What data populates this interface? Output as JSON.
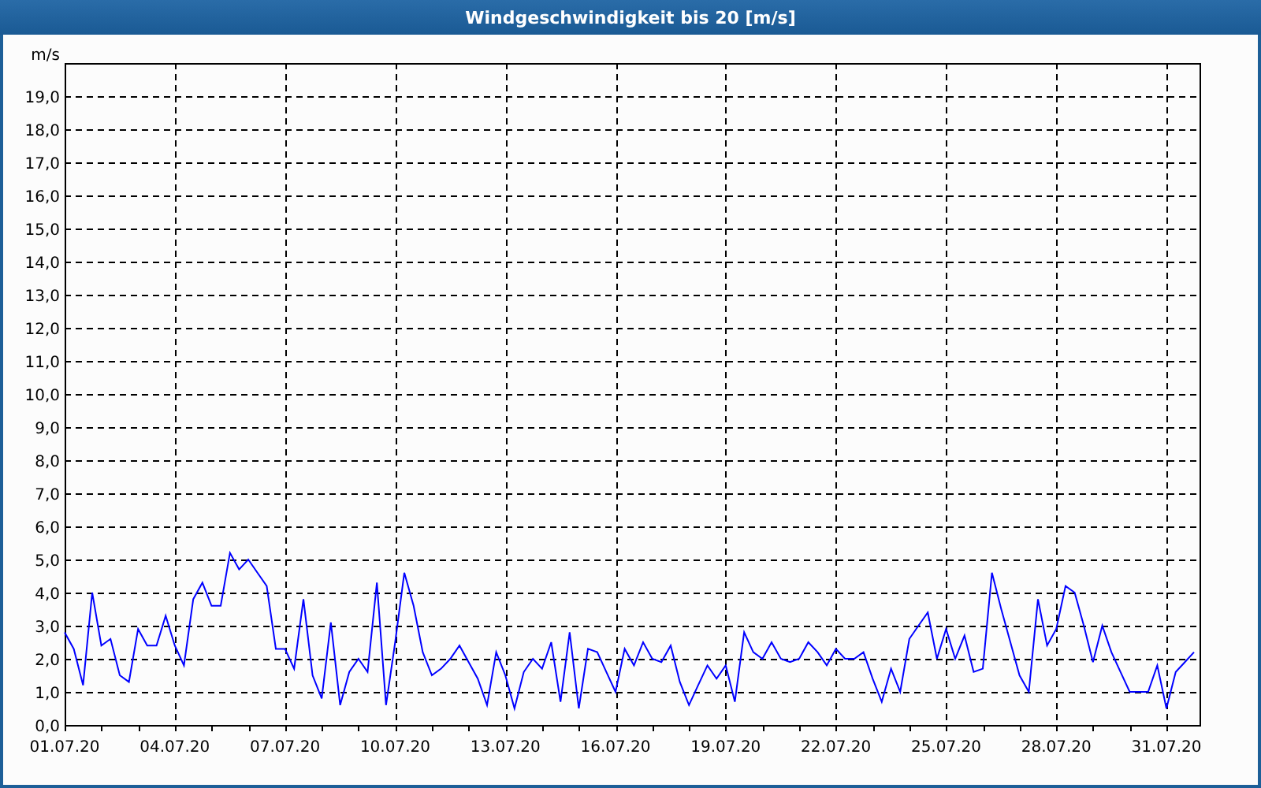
{
  "window": {
    "title": "Windgeschwindigkeit bis 20 [m/s]"
  },
  "chart_data": {
    "type": "line",
    "ylabel": "m/s",
    "categories": [
      "01.07.20",
      null,
      null,
      null,
      null,
      null,
      null,
      null,
      null,
      null,
      null,
      null,
      "04.07.20",
      null,
      null,
      null,
      null,
      null,
      null,
      null,
      null,
      null,
      null,
      null,
      "07.07.20",
      null,
      null,
      null,
      null,
      null,
      null,
      null,
      null,
      null,
      null,
      null,
      "10.07.20",
      null,
      null,
      null,
      null,
      null,
      null,
      null,
      null,
      null,
      null,
      null,
      "13.07.20",
      null,
      null,
      null,
      null,
      null,
      null,
      null,
      null,
      null,
      null,
      null,
      "16.07.20",
      null,
      null,
      null,
      null,
      null,
      null,
      null,
      null,
      null,
      null,
      null,
      "19.07.20",
      null,
      null,
      null,
      null,
      null,
      null,
      null,
      null,
      null,
      null,
      null,
      "22.07.20",
      null,
      null,
      null,
      null,
      null,
      null,
      null,
      null,
      null,
      null,
      null,
      "25.07.20",
      null,
      null,
      null,
      null,
      null,
      null,
      null,
      null,
      null,
      null,
      null,
      "28.07.20",
      null,
      null,
      null,
      null,
      null,
      null,
      null,
      null,
      null,
      null,
      null,
      "31.07.20",
      null,
      null,
      null
    ],
    "series": [
      {
        "color": "#0000ff",
        "values": [
          2.8,
          2.3,
          1.2,
          4.0,
          2.4,
          2.6,
          1.5,
          1.3,
          2.9,
          2.4,
          2.4,
          3.3,
          2.4,
          1.8,
          3.8,
          4.3,
          3.6,
          3.6,
          5.2,
          4.7,
          5.0,
          4.6,
          4.2,
          2.3,
          2.3,
          1.7,
          3.8,
          1.5,
          0.8,
          3.1,
          0.6,
          1.6,
          2.0,
          1.6,
          4.3,
          0.6,
          2.5,
          4.6,
          3.6,
          2.2,
          1.5,
          1.7,
          2.0,
          2.4,
          1.9,
          1.4,
          0.6,
          2.2,
          1.5,
          0.5,
          1.6,
          2.0,
          1.7,
          2.5,
          0.7,
          2.8,
          0.5,
          2.3,
          2.2,
          1.6,
          1.0,
          2.3,
          1.8,
          2.5,
          2.0,
          1.9,
          2.4,
          1.3,
          0.6,
          1.2,
          1.8,
          1.4,
          1.8,
          0.7,
          2.8,
          2.2,
          2.0,
          2.5,
          2.0,
          1.9,
          2.0,
          2.5,
          2.2,
          1.8,
          2.3,
          2.0,
          2.0,
          2.2,
          1.4,
          0.7,
          1.7,
          1.0,
          2.6,
          3.0,
          3.4,
          2.0,
          2.9,
          2.0,
          2.7,
          1.6,
          1.7,
          4.6,
          3.5,
          2.5,
          1.5,
          1.0,
          3.8,
          2.4,
          2.9,
          4.2,
          4.0,
          3.0,
          1.9,
          3.0,
          2.2,
          1.6,
          1.0,
          1.0,
          1.0,
          1.8,
          0.5,
          1.6,
          1.9,
          2.2
        ]
      }
    ],
    "grid": true,
    "ylim": [
      0,
      20
    ],
    "yticks": [
      {
        "value": 0,
        "label": "0,0"
      },
      {
        "value": 1,
        "label": "1,0"
      },
      {
        "value": 2,
        "label": "2,0"
      },
      {
        "value": 3,
        "label": "3,0"
      },
      {
        "value": 4,
        "label": "4,0"
      },
      {
        "value": 5,
        "label": "5,0"
      },
      {
        "value": 6,
        "label": "6,0"
      },
      {
        "value": 7,
        "label": "7,0"
      },
      {
        "value": 8,
        "label": "8,0"
      },
      {
        "value": 9,
        "label": "9,0"
      },
      {
        "value": 10,
        "label": "10,0"
      },
      {
        "value": 11,
        "label": "11,0"
      },
      {
        "value": 12,
        "label": "12,0"
      },
      {
        "value": 13,
        "label": "13,0"
      },
      {
        "value": 14,
        "label": "14,0"
      },
      {
        "value": 15,
        "label": "15,0"
      },
      {
        "value": 16,
        "label": "16,0"
      },
      {
        "value": 17,
        "label": "17,0"
      },
      {
        "value": 18,
        "label": "18,0"
      },
      {
        "value": 19,
        "label": "19,0"
      }
    ]
  }
}
